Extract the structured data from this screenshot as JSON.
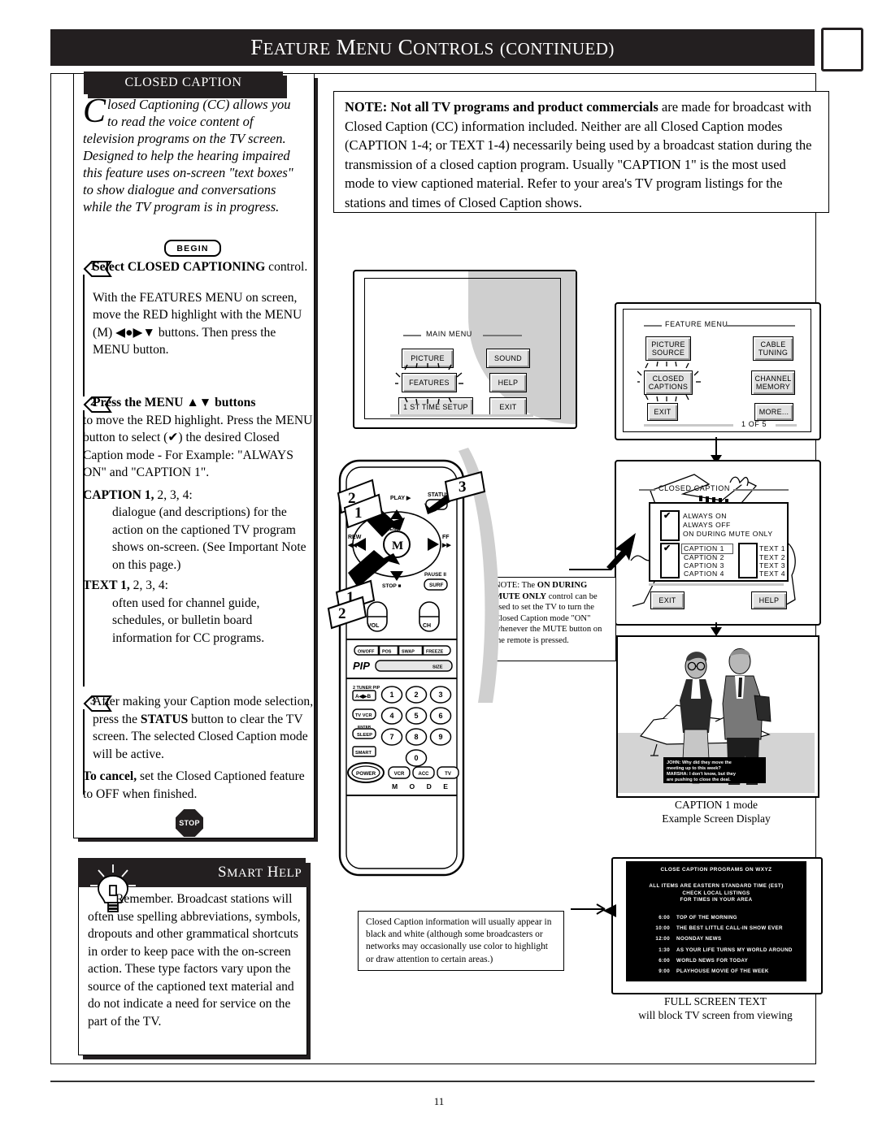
{
  "header": {
    "title_main": "F",
    "title": "FEATURE MENU CONTROLS (CONTINUED)",
    "title_parts": [
      "F",
      "EATURE ",
      "M",
      "ENU ",
      "C",
      "ONTROLS ",
      "(",
      "CONTINUED",
      ")"
    ]
  },
  "page_number": "11",
  "left_panel": {
    "tab_label": "CLOSED CAPTION",
    "intro_dropcap": "C",
    "intro": "losed Captioning (CC) allows you to read the voice content of television programs on the TV screen. Designed to help the hearing impaired this feature uses on-screen \"text boxes\" to show dialogue and conversations while the TV program is in progress.",
    "begin_label": "BEGIN",
    "steps": [
      {
        "number": "1",
        "heading_bold": "Select CLOSED CAPTIONING",
        "heading_rest": " control.",
        "body": "With the FEATURES MENU on screen, move the RED highlight with the MENU (M) ◀●▶▼ buttons. Then press the MENU button."
      },
      {
        "number": "2",
        "heading_bold": "Press the MENU ▲▼ buttons",
        "heading_rest": "",
        "body": "to move the RED highlight. Press the MENU button to select (✔) the desired Closed Caption mode - For Example: \"ALWAYS ON\" and \"CAPTION 1\".",
        "sub_terms": [
          {
            "term_bold": "CAPTION 1,",
            "term_rest": " 2, 3, 4:",
            "desc": "dialogue (and descriptions) for the action on the captioned TV program shows on-screen. (See Important Note on this page.)"
          },
          {
            "term_bold": "TEXT 1,",
            "term_rest": " 2, 3, 4:",
            "desc": "often used for channel guide, schedules, or bulletin board information for CC programs."
          }
        ]
      },
      {
        "number": "3",
        "heading_bold": "",
        "heading_rest": "",
        "body_pre": "After making your Caption mode selection, press the ",
        "body_bold": "STATUS",
        "body_post": " button to clear the TV screen. The selected Closed Caption mode will be active."
      }
    ],
    "cancel_bold": "To cancel,",
    "cancel_rest": " set the Closed Captioned feature to OFF when finished.",
    "stop_label": "STOP"
  },
  "smart_help": {
    "title": "SMART HELP",
    "title_parts": [
      "S",
      "MART ",
      "H",
      "ELP"
    ],
    "body": "Remember.  Broadcast stations will often use spelling abbreviations, symbols, dropouts and other grammatical shortcuts in order to keep pace with the on-screen action. These type factors vary upon the source of the captioned text material and do not indicate a need for service on the part of the TV."
  },
  "note_box": {
    "lead_bold": "NOTE: Not all TV programs and product commercials",
    "rest": " are made for broadcast with Closed Caption (CC) information included. Neither are all Closed Caption modes (CAPTION 1-4; or TEXT 1-4) necessarily being used by a broadcast station during the transmission of a closed caption program. Usually \"CAPTION 1\" is the most used mode to view captioned material. Refer to your area's TV program listings for the stations and times of Closed Caption shows."
  },
  "main_menu": {
    "title": "MAIN MENU",
    "buttons_left": [
      "PICTURE",
      "FEATURES",
      "1 ST TIME SETUP"
    ],
    "buttons_right": [
      "SOUND",
      "HELP",
      "EXIT"
    ],
    "highlighted": "FEATURES"
  },
  "feature_menu": {
    "title": "FEATURE MENU",
    "buttons_left": [
      [
        "PICTURE",
        "SOURCE"
      ],
      [
        "CLOSED",
        "CAPTIONS"
      ],
      [
        "EXIT"
      ]
    ],
    "buttons_right": [
      [
        "CABLE",
        "TUNING"
      ],
      [
        "CHANNEL",
        "MEMORY"
      ],
      [
        "MORE..."
      ]
    ],
    "highlighted": "CLOSED CAPTIONS",
    "page_indicator": "1 OF 5"
  },
  "cc_menu": {
    "title": "CLOSED CAPTION",
    "mode_options": [
      "ALWAYS ON",
      "ALWAYS OFF",
      "ON DURING MUTE ONLY"
    ],
    "mode_checked": "ALWAYS ON",
    "caption_options": [
      "CAPTION 1",
      "CAPTION 2",
      "CAPTION 3",
      "CAPTION 4"
    ],
    "caption_checked": "CAPTION 1",
    "text_options": [
      "TEXT 1",
      "TEXT 2",
      "TEXT 3",
      "TEXT 4"
    ],
    "buttons": [
      "EXIT",
      "HELP"
    ]
  },
  "mid_note": {
    "pre": "NOTE: The ",
    "bold": "ON DURING MUTE ONLY",
    "post": " control can be used to set the TV to turn the Closed Caption mode \"ON\" whenever the MUTE button on the remote is pressed."
  },
  "bw_note": {
    "text": "Closed Caption information will usually appear in black and white (although some broadcasters or networks may occasionally use color to highlight or draw attention to certain areas.)"
  },
  "example_screen": {
    "caption_lines": [
      "JOHN: Why did they move  the",
      "meeting up to this week?",
      "MARSHA: I don't know, but they",
      "are pushing to close the deal."
    ],
    "caption_line1": "CAPTION 1 mode",
    "caption_line2": "Example Screen Display"
  },
  "full_screen_text": {
    "header": "CLOSE CAPTION PROGRAMS ON WXYZ",
    "subheader": [
      "ALL ITEMS ARE EASTERN STANDARD TIME (EST)",
      "CHECK LOCAL LISTINGS",
      "FOR TIMES IN YOUR AREA"
    ],
    "listings": [
      {
        "time": "6:00",
        "title": "TOP OF THE MORNING"
      },
      {
        "time": "10:00",
        "title": "THE BEST LITTLE CALL-IN SHOW EVER"
      },
      {
        "time": "12:00",
        "title": "NOONDAY NEWS"
      },
      {
        "time": "1:30",
        "title": "AS YOUR LIFE TURNS MY WORLD AROUND"
      },
      {
        "time": "6:00",
        "title": "WORLD NEWS FOR TODAY"
      },
      {
        "time": "9:00",
        "title": "PLAYHOUSE MOVIE OF THE WEEK"
      }
    ],
    "caption_line1": "FULL SCREEN TEXT",
    "caption_line2": "will block TV screen from viewing"
  },
  "remote": {
    "labels": {
      "play": "PLAY ▶",
      "status": "STATUS",
      "rew": "REW",
      "rew_icon": "◀◀",
      "ff": "FF",
      "ff_icon": "▶▶",
      "menu": "MENU",
      "menu_key": "M",
      "stop": "STOP",
      "pause": "PAUSE",
      "surf": "SURF",
      "vol": "VOL",
      "ch": "CH",
      "pip": "PIP",
      "size": "SIZE",
      "on_off": "ON/OFF",
      "pos": "POS",
      "swap": "SWAP",
      "freeze": "FREEZE",
      "tuner_pip": "2 TUNER PIP",
      "tv_vcr": "TV VCR",
      "enter": "ENTER",
      "sleep": "SLEEP",
      "smart": "SMART",
      "power": "POWER",
      "mode": "M  O  D  E",
      "mode_buttons": [
        "VCR",
        "ACC",
        "TV"
      ]
    },
    "keypad": [
      "1",
      "2",
      "3",
      "4",
      "5",
      "6",
      "7",
      "8",
      "9",
      "0"
    ],
    "step_flags": [
      "2",
      "1",
      "3",
      "1",
      "2"
    ]
  }
}
